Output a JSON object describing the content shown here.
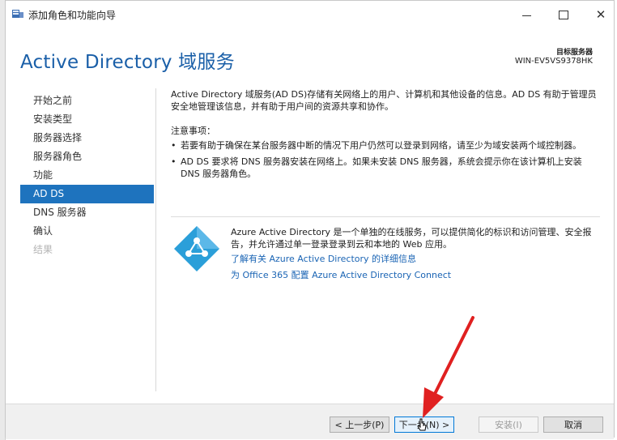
{
  "window": {
    "title": "添加角色和功能向导"
  },
  "header": {
    "title": "Active Directory 域服务",
    "target_label": "目标服务器",
    "target_value": "WIN-EV5VS9378HK"
  },
  "nav": {
    "items": [
      {
        "label": "开始之前",
        "state": "normal"
      },
      {
        "label": "安装类型",
        "state": "normal"
      },
      {
        "label": "服务器选择",
        "state": "normal"
      },
      {
        "label": "服务器角色",
        "state": "normal"
      },
      {
        "label": "功能",
        "state": "normal"
      },
      {
        "label": "AD DS",
        "state": "active"
      },
      {
        "label": "DNS 服务器",
        "state": "normal"
      },
      {
        "label": "确认",
        "state": "normal"
      },
      {
        "label": "结果",
        "state": "disabled"
      }
    ]
  },
  "content": {
    "intro": "Active Directory 域服务(AD DS)存储有关网络上的用户、计算机和其他设备的信息。AD DS 有助于管理员安全地管理该信息，并有助于用户间的资源共享和协作。",
    "notice_heading": "注意事项：",
    "bullets": [
      "若要有助于确保在某台服务器中断的情况下用户仍然可以登录到网络，请至少为域安装两个域控制器。",
      "AD DS 要求将 DNS 服务器安装在网络上。如果未安装 DNS 服务器，系统会提示你在该计算机上安装 DNS 服务器角色。"
    ],
    "azure_text": "Azure Active Directory 是一个单独的在线服务，可以提供简化的标识和访问管理、安全报告，并允许通过单一登录登录到云和本地的 Web 应用。",
    "link1": "了解有关 Azure Active Directory 的详细信息",
    "link2": "为 Office 365 配置 Azure Active Directory Connect"
  },
  "footer": {
    "prev": "< 上一步(P)",
    "next": "下一步(N) >",
    "install": "安装(I)",
    "cancel": "取消"
  },
  "colors": {
    "accent": "#1e73be",
    "link": "#1a64b4",
    "header": "#1a5fa8",
    "arrow": "#e02020",
    "azure": "#2b9fd9"
  }
}
